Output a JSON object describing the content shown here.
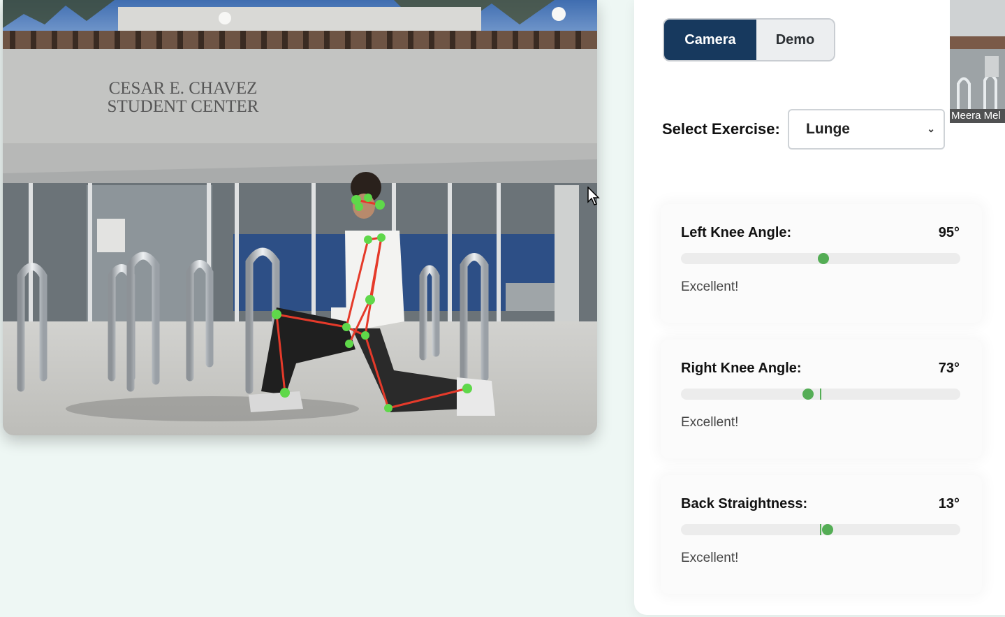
{
  "mode_toggle": {
    "options": [
      "Camera",
      "Demo"
    ],
    "active": "Camera"
  },
  "exercise": {
    "label": "Select Exercise:",
    "selected": "Lunge"
  },
  "metrics": [
    {
      "name": "Left Knee Angle:",
      "value": "95°",
      "feedback": "Excellent!",
      "level": 0.51,
      "target": null
    },
    {
      "name": "Right Knee Angle:",
      "value": "73°",
      "feedback": "Excellent!",
      "level": 0.455,
      "target": 0.5
    },
    {
      "name": "Back Straightness:",
      "value": "13°",
      "feedback": "Excellent!",
      "level": 0.525,
      "target": 0.5
    }
  ],
  "video": {
    "building_sign_line1": "CESAR E. CHAVEZ",
    "building_sign_line2": "STUDENT CENTER",
    "skeleton_color": "#e53a2a",
    "joint_color": "#5fd84a"
  },
  "participant": {
    "name": "Meera Mel"
  },
  "colors": {
    "accent": "#17395e",
    "good": "#54ad55",
    "background": "#eef7f4"
  }
}
